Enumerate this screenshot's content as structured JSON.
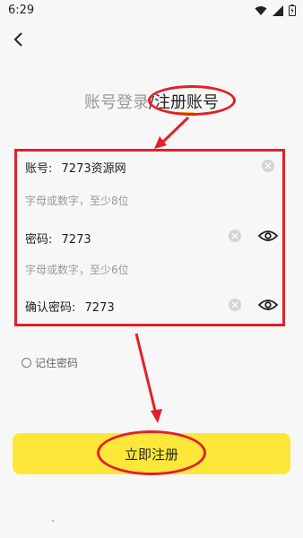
{
  "status": {
    "time": "6:29"
  },
  "header": {
    "login_tab": "账号登录",
    "separator": "/",
    "register_tab": "注册账号"
  },
  "form": {
    "account": {
      "label": "账号:",
      "value": "7273资源网"
    },
    "account_hint": "字母或数字，至少8位",
    "password": {
      "label": "密码:",
      "value": "7273"
    },
    "password_hint": "字母或数字，至少6位",
    "confirm": {
      "label": "确认密码:",
      "value": "7273"
    }
  },
  "remember": {
    "label": "记住密码",
    "checked": false
  },
  "register_button": {
    "label": "立即注册"
  },
  "colors": {
    "accent": "#fde83a",
    "annotation": "#e2202a",
    "underline": "#f3c300"
  }
}
